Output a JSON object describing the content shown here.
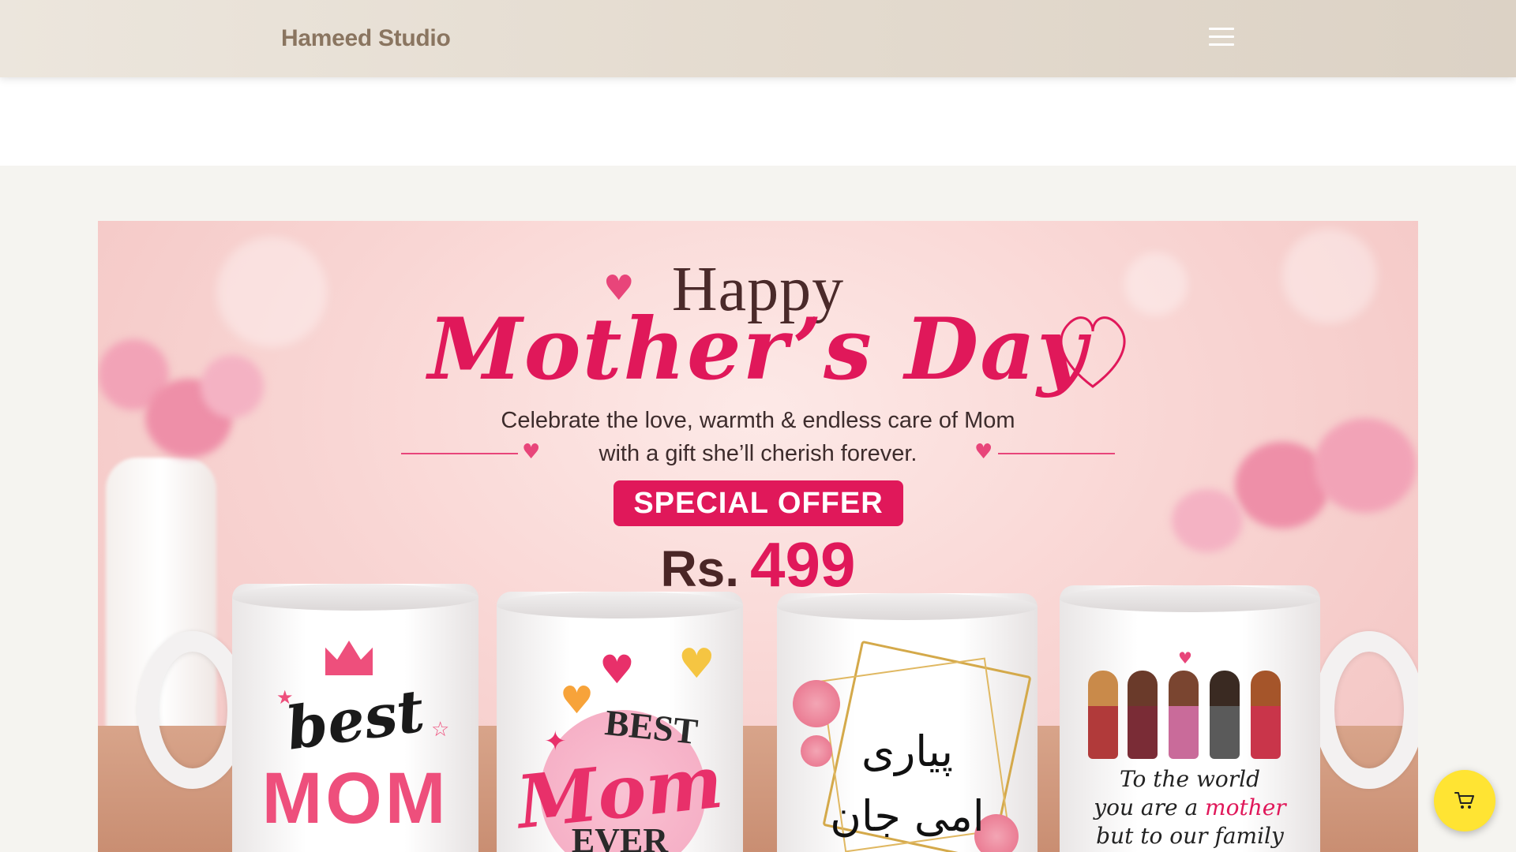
{
  "header": {
    "logo_text": "Hameed Studio",
    "menu_icon": "hamburger-menu-icon"
  },
  "banner": {
    "happy": "Happy",
    "mothers_day": "Mother’s Day",
    "tagline_line1": "Celebrate the love, warmth & endless care of Mom",
    "tagline_line2": "with a gift she’ll cherish forever.",
    "offer_label": "SPECIAL OFFER",
    "price_currency": "Rs.",
    "price_amount": "499",
    "mugs": [
      {
        "line1": "best",
        "line2": "MOM"
      },
      {
        "line1": "BEST",
        "line2": "Mom",
        "line3": "EVER"
      },
      {
        "line1": "پیاری",
        "line2": "امی جان"
      },
      {
        "line1": "To the world",
        "line2_a": "you are a ",
        "line2_b": "mother",
        "line3": "but to our family"
      }
    ]
  },
  "cart": {
    "icon": "shopping-cart-icon"
  },
  "colors": {
    "header_bg": "#e4dbcf",
    "logo": "#8a7560",
    "brand_pink": "#e0185a",
    "cart_fab": "#ffe433",
    "page_bg": "#f5f4f0"
  }
}
